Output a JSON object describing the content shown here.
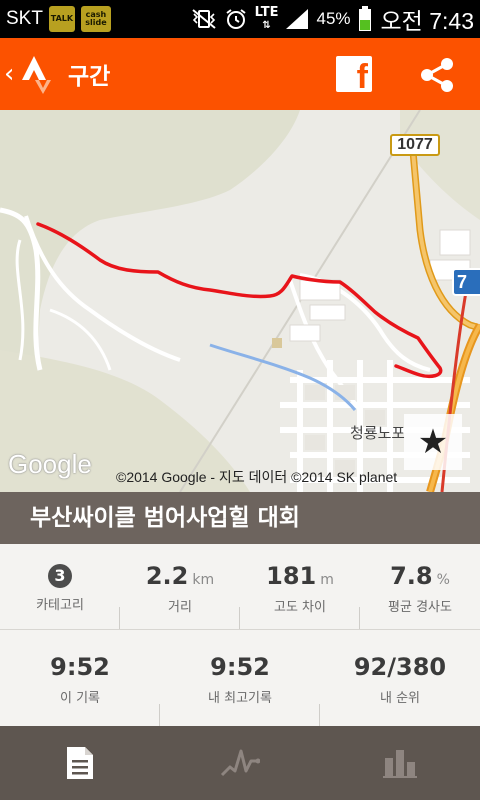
{
  "status_bar": {
    "carrier": "SKT",
    "app_icons": [
      "TALK",
      "cash slide"
    ],
    "network": "LTE",
    "battery_percent": "45%",
    "time": "오전 7:43"
  },
  "action_bar": {
    "title": "구간",
    "back_glyph": "‹",
    "facebook_glyph": "f"
  },
  "map": {
    "road_shield_1": "1077",
    "road_shield_2": "7",
    "place_label": "청룡노포",
    "google_logo": "Google",
    "copyright": "©2014 Google - 지도 데이터 ©2014 SK planet",
    "route_color": "#e8141a",
    "star_glyph": "★"
  },
  "segment": {
    "title": "부산싸이클 범어사업힐 대회"
  },
  "stats_row1": [
    {
      "key": "category",
      "value": "3",
      "unit": "",
      "label": "카테고리"
    },
    {
      "key": "distance",
      "value": "2.2",
      "unit": "km",
      "label": "거리"
    },
    {
      "key": "elevation",
      "value": "181",
      "unit": "m",
      "label": "고도 차이"
    },
    {
      "key": "grade",
      "value": "7.8",
      "unit": "%",
      "label": "평균 경사도"
    }
  ],
  "stats_row2": [
    {
      "key": "kom",
      "value": "9:52",
      "label": "이 기록"
    },
    {
      "key": "pr",
      "value": "9:52",
      "label": "내 최고기록"
    },
    {
      "key": "rank",
      "value": "92/380",
      "label": "내 순위"
    }
  ],
  "bottom_nav": [
    {
      "key": "details",
      "icon": "document-icon",
      "active": true
    },
    {
      "key": "activity",
      "icon": "pulse-icon",
      "active": false
    },
    {
      "key": "leaderboard",
      "icon": "bar-chart-icon",
      "active": false
    }
  ],
  "colors": {
    "brand": "#fc5200",
    "header_bar": "#6d645e",
    "nav_bg": "#5e5650"
  }
}
